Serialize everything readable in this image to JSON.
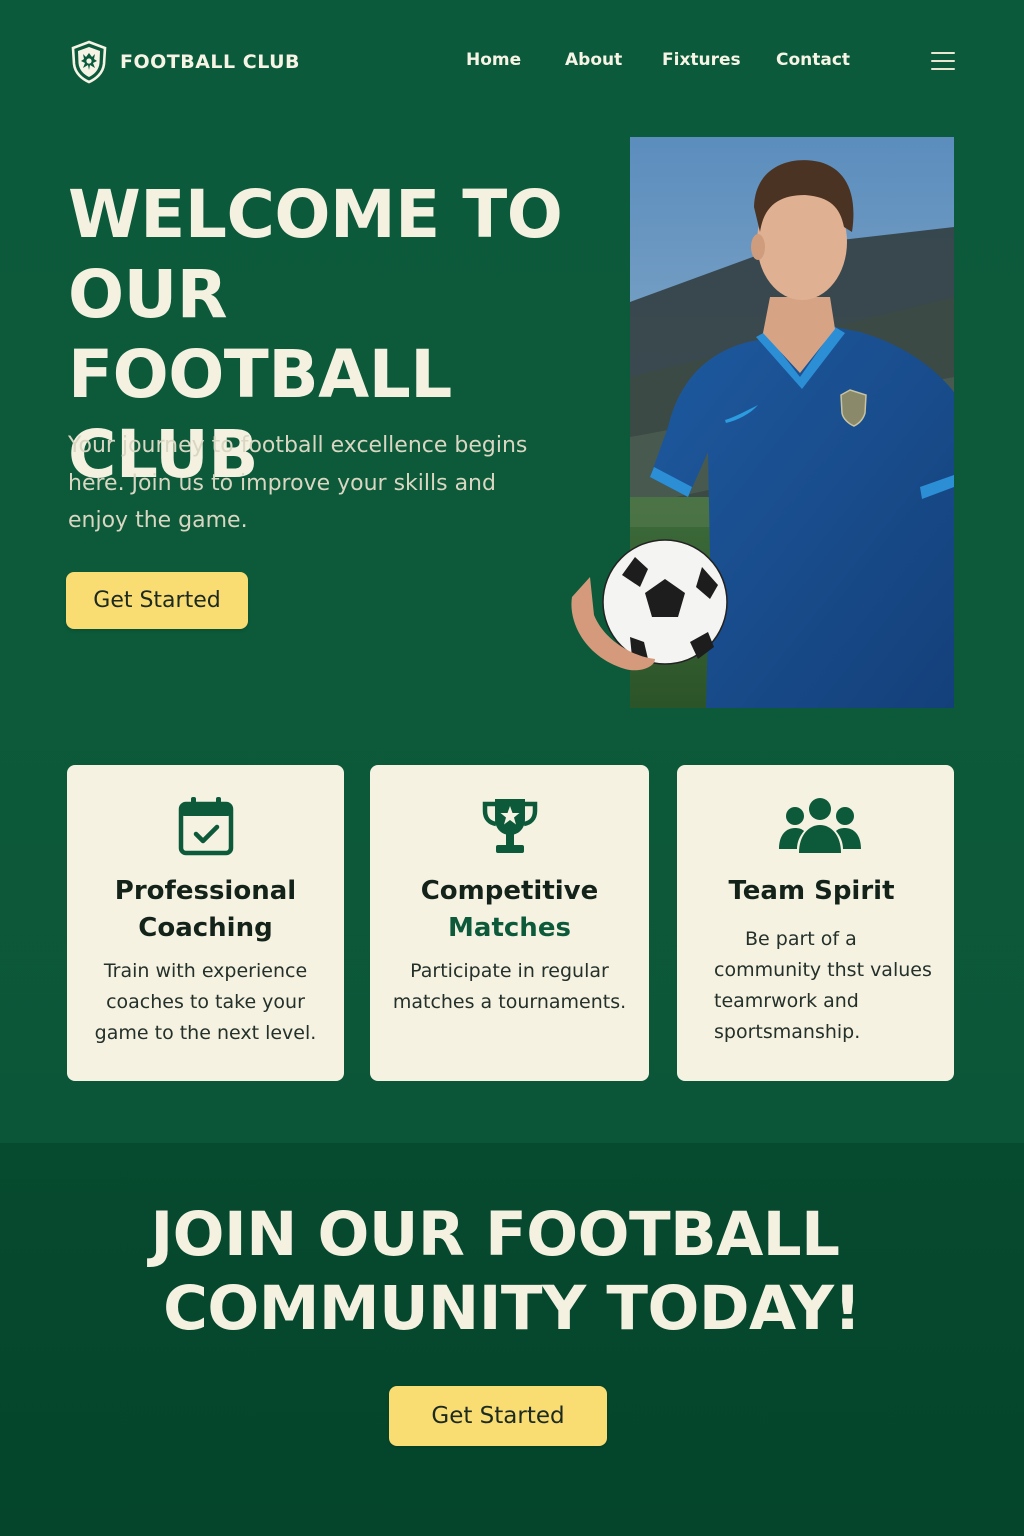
{
  "nav": {
    "brand": "FOOTBALL CLUB",
    "brand_icon": "shield-crest-icon",
    "links": [
      "Home",
      "About",
      "Fixtures",
      "Contact"
    ],
    "menu_icon": "hamburger-menu-icon"
  },
  "hero": {
    "title_lines": [
      "WELCOME TO",
      "OUR FOOTBALL",
      "CLUB"
    ],
    "subtitle_lines": [
      "Your journey to football excellence begins",
      "here. Join us to improve your skills and",
      "enjoy the game."
    ],
    "button": "Get Started",
    "photo": "football-player-holding-ball-photo"
  },
  "features": [
    {
      "icon": "calendar-check-icon",
      "title_lines": [
        "Professional",
        "Coaching"
      ],
      "text_lines": [
        "Train with experience",
        "coaches to take your",
        "game to the next level."
      ]
    },
    {
      "icon": "trophy-icon",
      "title_lines": [
        "Competitive",
        "Matches"
      ],
      "text_lines": [
        "Participate in regular",
        "matches a tournaments."
      ]
    },
    {
      "icon": "team-group-icon",
      "title_lines": [
        "Team Spirit"
      ],
      "text_lines": [
        "Be part of a",
        "community thst values",
        "teamrwork and",
        "sportsmanship."
      ]
    }
  ],
  "cta": {
    "title_lines": [
      "JOIN OUR FOOTBALL",
      "COMMUNITY TODAY!"
    ],
    "button": "Get Started"
  },
  "colors": {
    "background_green": "#0c5a3a",
    "dark_green": "#04452b",
    "cream": "#f5f2e1",
    "button_yellow": "#f9dc72"
  }
}
